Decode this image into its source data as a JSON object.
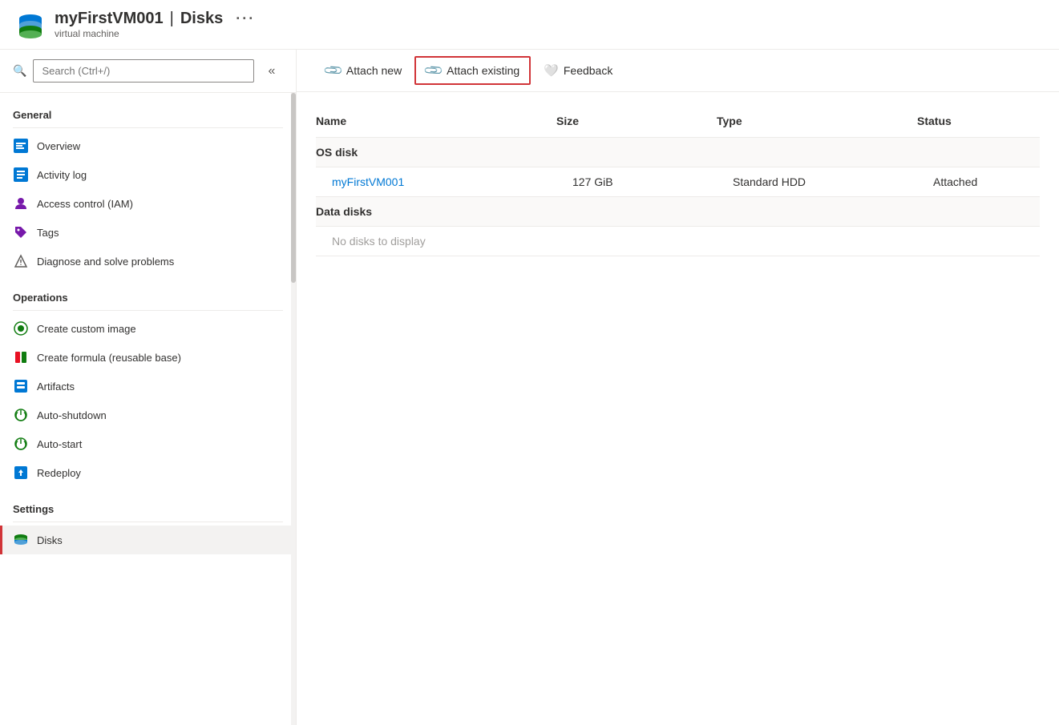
{
  "header": {
    "title": "myFirstVM001 | Disks",
    "vm_name": "myFirstVM001",
    "separator": "|",
    "page": "Disks",
    "subtitle": "virtual machine",
    "more_label": "···"
  },
  "sidebar": {
    "search_placeholder": "Search (Ctrl+/)",
    "collapse_icon": "«",
    "sections": [
      {
        "label": "General",
        "items": [
          {
            "id": "overview",
            "label": "Overview",
            "icon": "overview-icon"
          },
          {
            "id": "activity-log",
            "label": "Activity log",
            "icon": "activity-log-icon"
          },
          {
            "id": "access-control",
            "label": "Access control (IAM)",
            "icon": "iam-icon"
          },
          {
            "id": "tags",
            "label": "Tags",
            "icon": "tag-icon"
          },
          {
            "id": "diagnose",
            "label": "Diagnose and solve problems",
            "icon": "diagnose-icon"
          }
        ]
      },
      {
        "label": "Operations",
        "items": [
          {
            "id": "custom-image",
            "label": "Create custom image",
            "icon": "image-icon"
          },
          {
            "id": "formula",
            "label": "Create formula (reusable base)",
            "icon": "formula-icon"
          },
          {
            "id": "artifacts",
            "label": "Artifacts",
            "icon": "artifacts-icon"
          },
          {
            "id": "auto-shutdown",
            "label": "Auto-shutdown",
            "icon": "shutdown-icon"
          },
          {
            "id": "auto-start",
            "label": "Auto-start",
            "icon": "autostart-icon"
          },
          {
            "id": "redeploy",
            "label": "Redeploy",
            "icon": "redeploy-icon"
          }
        ]
      },
      {
        "label": "Settings",
        "items": [
          {
            "id": "disks",
            "label": "Disks",
            "icon": "disks-icon",
            "active": true
          }
        ]
      }
    ]
  },
  "toolbar": {
    "attach_new_label": "Attach new",
    "attach_existing_label": "Attach existing",
    "feedback_label": "Feedback"
  },
  "table": {
    "columns": [
      "Name",
      "Size",
      "Type",
      "Status"
    ],
    "os_disk_section": "OS disk",
    "data_disks_section": "Data disks",
    "os_disk_row": {
      "name": "myFirstVM001",
      "size": "127 GiB",
      "type": "Standard HDD",
      "status": "Attached"
    },
    "no_data_label": "No disks to display"
  }
}
